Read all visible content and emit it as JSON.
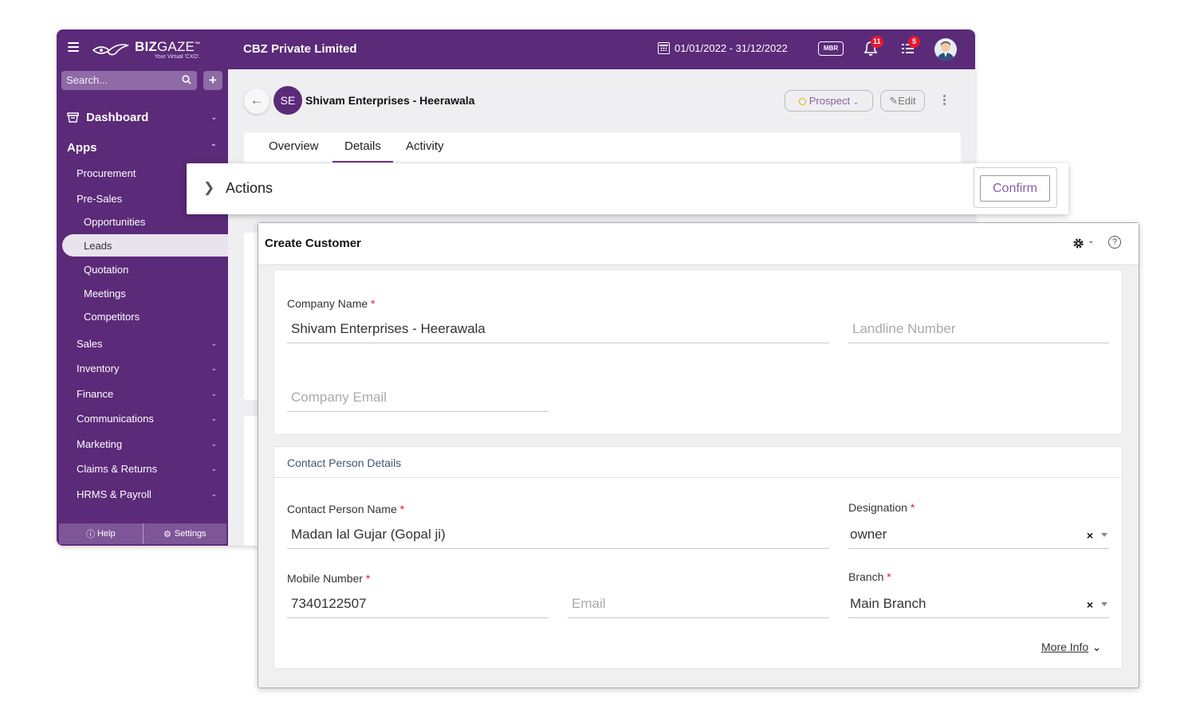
{
  "app": {
    "logo_name_bold": "BIZ",
    "logo_name_light": "GAZE",
    "logo_trademark": "™",
    "logo_tagline": "Your Virtual 'CXO'.",
    "company": "CBZ Private Limited",
    "date_range": "01/01/2022 - 31/12/2022",
    "mbr_label": "MBR",
    "notifications_count": "11",
    "tasks_count": "5",
    "brand_color": "#5b2a79"
  },
  "sidebar": {
    "search_placeholder": "Search...",
    "plus_label": "+",
    "dashboard": "Dashboard",
    "apps": "Apps",
    "procurement": "Procurement",
    "presales": "Pre-Sales",
    "opportunities": "Opportunities",
    "leads": "Leads",
    "quotation": "Quotation",
    "meetings": "Meetings",
    "competitors": "Competitors",
    "sales": "Sales",
    "inventory": "Inventory",
    "finance": "Finance",
    "communications": "Communications",
    "marketing": "Marketing",
    "claims": "Claims & Returns",
    "hrms": "HRMS & Payroll",
    "help": "Help",
    "settings": "Settings"
  },
  "lead": {
    "initials": "SE",
    "name": "Shivam Enterprises - Heerawala",
    "status": "Prospect",
    "edit_label": "Edit"
  },
  "tabs": {
    "overview": "Overview",
    "details": "Details",
    "activity": "Activity"
  },
  "actions": {
    "title": "Actions",
    "confirm_label": "Confirm"
  },
  "form": {
    "title": "Create Customer",
    "company_name_label": "Company Name",
    "company_name_value": "Shivam Enterprises  - Heerawala",
    "landline_placeholder": "Landline Number",
    "company_email_placeholder": "Company Email",
    "contact_section_title": "Contact Person Details",
    "contact_name_label": "Contact Person Name",
    "contact_name_value": "Madan lal Gujar (Gopal ji)",
    "designation_label": "Designation",
    "designation_value": "owner",
    "mobile_label": "Mobile Number",
    "mobile_value": "7340122507",
    "email_placeholder": "Email",
    "branch_label": "Branch",
    "branch_value": "Main Branch",
    "more_info_label": "More Info",
    "required_mark": "*",
    "clear_mark": "×"
  }
}
